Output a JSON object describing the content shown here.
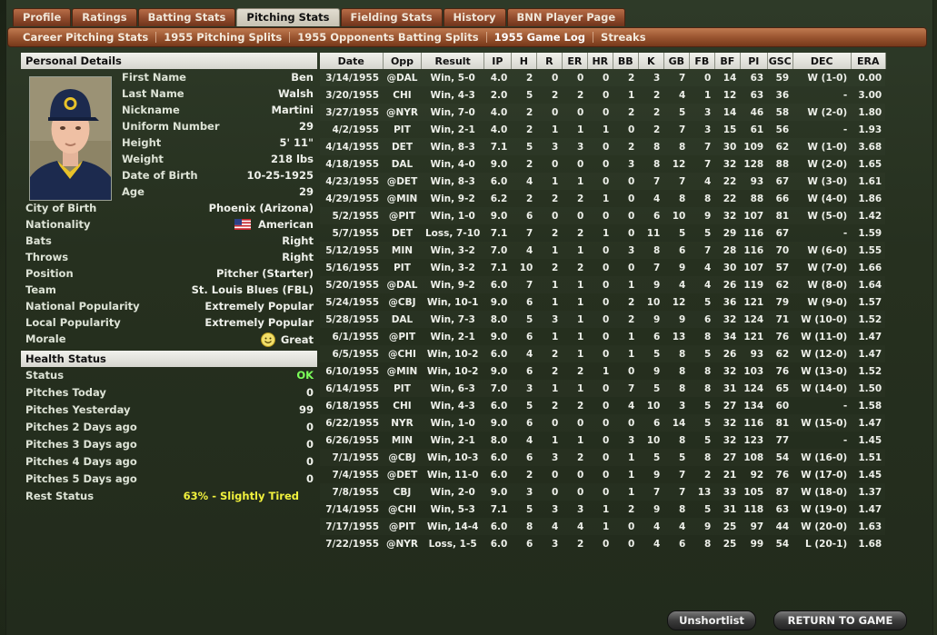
{
  "tabs": [
    {
      "label": "Profile"
    },
    {
      "label": "Ratings"
    },
    {
      "label": "Batting Stats"
    },
    {
      "label": "Pitching Stats"
    },
    {
      "label": "Fielding Stats"
    },
    {
      "label": "History"
    },
    {
      "label": "BNN Player Page"
    }
  ],
  "subtabs": [
    {
      "label": "Career Pitching Stats"
    },
    {
      "label": "1955 Pitching Splits"
    },
    {
      "label": "1955 Opponents Batting Splits"
    },
    {
      "label": "1955 Game Log"
    },
    {
      "label": "Streaks"
    }
  ],
  "personal": {
    "title": "Personal Details",
    "first_name_label": "First Name",
    "first_name": "Ben",
    "last_name_label": "Last Name",
    "last_name": "Walsh",
    "nickname_label": "Nickname",
    "nickname": "Martini",
    "uniform_label": "Uniform Number",
    "uniform": "29",
    "height_label": "Height",
    "height": "5' 11\"",
    "weight_label": "Weight",
    "weight": "218 lbs",
    "dob_label": "Date of Birth",
    "dob": "10-25-1925",
    "age_label": "Age",
    "age": "29",
    "city_label": "City of Birth",
    "city": "Phoenix (Arizona)",
    "nationality_label": "Nationality",
    "nationality": "American",
    "bats_label": "Bats",
    "bats": "Right",
    "throws_label": "Throws",
    "throws": "Right",
    "position_label": "Position",
    "position": "Pitcher (Starter)",
    "team_label": "Team",
    "team": "St. Louis Blues (FBL)",
    "natpop_label": "National Popularity",
    "natpop": "Extremely Popular",
    "locpop_label": "Local Popularity",
    "locpop": "Extremely Popular",
    "morale_label": "Morale",
    "morale": "Great"
  },
  "health": {
    "title": "Health Status",
    "status_label": "Status",
    "status": "OK",
    "today_label": "Pitches Today",
    "today": "0",
    "yesterday_label": "Pitches Yesterday",
    "yesterday": "99",
    "d2_label": "Pitches 2 Days ago",
    "d2": "0",
    "d3_label": "Pitches 3 Days ago",
    "d3": "0",
    "d4_label": "Pitches 4 Days ago",
    "d4": "0",
    "d5_label": "Pitches 5 Days ago",
    "d5": "0",
    "rest_label": "Rest Status",
    "rest": "63% - Slightly Tired"
  },
  "gamelog": {
    "headers": [
      "Date",
      "Opp",
      "Result",
      "IP",
      "H",
      "R",
      "ER",
      "HR",
      "BB",
      "K",
      "GB",
      "FB",
      "BF",
      "PI",
      "GSC",
      "DEC",
      "ERA"
    ],
    "rows": [
      [
        "3/14/1955",
        "@DAL",
        "Win, 5-0",
        "4.0",
        "2",
        "0",
        "0",
        "0",
        "2",
        "3",
        "7",
        "0",
        "14",
        "63",
        "59",
        "W (1-0)",
        "0.00"
      ],
      [
        "3/20/1955",
        "CHI",
        "Win, 4-3",
        "2.0",
        "5",
        "2",
        "2",
        "0",
        "1",
        "2",
        "4",
        "1",
        "12",
        "63",
        "36",
        "-",
        "3.00"
      ],
      [
        "3/27/1955",
        "@NYR",
        "Win, 7-0",
        "4.0",
        "2",
        "0",
        "0",
        "0",
        "2",
        "2",
        "5",
        "3",
        "14",
        "46",
        "58",
        "W (2-0)",
        "1.80"
      ],
      [
        "4/2/1955",
        "PIT",
        "Win, 2-1",
        "4.0",
        "2",
        "1",
        "1",
        "1",
        "0",
        "2",
        "7",
        "3",
        "15",
        "61",
        "56",
        "-",
        "1.93"
      ],
      [
        "4/14/1955",
        "DET",
        "Win, 8-3",
        "7.1",
        "5",
        "3",
        "3",
        "0",
        "2",
        "8",
        "8",
        "7",
        "30",
        "109",
        "62",
        "W (1-0)",
        "3.68"
      ],
      [
        "4/18/1955",
        "DAL",
        "Win, 4-0",
        "9.0",
        "2",
        "0",
        "0",
        "0",
        "3",
        "8",
        "12",
        "7",
        "32",
        "128",
        "88",
        "W (2-0)",
        "1.65"
      ],
      [
        "4/23/1955",
        "@DET",
        "Win, 8-3",
        "6.0",
        "4",
        "1",
        "1",
        "0",
        "0",
        "7",
        "7",
        "4",
        "22",
        "93",
        "67",
        "W (3-0)",
        "1.61"
      ],
      [
        "4/29/1955",
        "@MIN",
        "Win, 9-2",
        "6.2",
        "2",
        "2",
        "2",
        "1",
        "0",
        "4",
        "8",
        "8",
        "22",
        "88",
        "66",
        "W (4-0)",
        "1.86"
      ],
      [
        "5/2/1955",
        "@PIT",
        "Win, 1-0",
        "9.0",
        "6",
        "0",
        "0",
        "0",
        "0",
        "6",
        "10",
        "9",
        "32",
        "107",
        "81",
        "W (5-0)",
        "1.42"
      ],
      [
        "5/7/1955",
        "DET",
        "Loss, 7-10",
        "7.1",
        "7",
        "2",
        "2",
        "1",
        "0",
        "11",
        "5",
        "5",
        "29",
        "116",
        "67",
        "-",
        "1.59"
      ],
      [
        "5/12/1955",
        "MIN",
        "Win, 3-2",
        "7.0",
        "4",
        "1",
        "1",
        "0",
        "3",
        "8",
        "6",
        "7",
        "28",
        "116",
        "70",
        "W (6-0)",
        "1.55"
      ],
      [
        "5/16/1955",
        "PIT",
        "Win, 3-2",
        "7.1",
        "10",
        "2",
        "2",
        "0",
        "0",
        "7",
        "9",
        "4",
        "30",
        "107",
        "57",
        "W (7-0)",
        "1.66"
      ],
      [
        "5/20/1955",
        "@DAL",
        "Win, 9-2",
        "6.0",
        "7",
        "1",
        "1",
        "0",
        "1",
        "9",
        "4",
        "4",
        "26",
        "119",
        "62",
        "W (8-0)",
        "1.64"
      ],
      [
        "5/24/1955",
        "@CBJ",
        "Win, 10-1",
        "9.0",
        "6",
        "1",
        "1",
        "0",
        "2",
        "10",
        "12",
        "5",
        "36",
        "121",
        "79",
        "W (9-0)",
        "1.57"
      ],
      [
        "5/28/1955",
        "DAL",
        "Win, 7-3",
        "8.0",
        "5",
        "3",
        "1",
        "0",
        "2",
        "9",
        "9",
        "6",
        "32",
        "124",
        "71",
        "W (10-0)",
        "1.52"
      ],
      [
        "6/1/1955",
        "@PIT",
        "Win, 2-1",
        "9.0",
        "6",
        "1",
        "1",
        "0",
        "1",
        "6",
        "13",
        "8",
        "34",
        "121",
        "76",
        "W (11-0)",
        "1.47"
      ],
      [
        "6/5/1955",
        "@CHI",
        "Win, 10-2",
        "6.0",
        "4",
        "2",
        "1",
        "0",
        "1",
        "5",
        "8",
        "5",
        "26",
        "93",
        "62",
        "W (12-0)",
        "1.47"
      ],
      [
        "6/10/1955",
        "@MIN",
        "Win, 10-2",
        "9.0",
        "6",
        "2",
        "2",
        "1",
        "0",
        "9",
        "8",
        "8",
        "32",
        "103",
        "76",
        "W (13-0)",
        "1.52"
      ],
      [
        "6/14/1955",
        "PIT",
        "Win, 6-3",
        "7.0",
        "3",
        "1",
        "1",
        "0",
        "7",
        "5",
        "8",
        "8",
        "31",
        "124",
        "65",
        "W (14-0)",
        "1.50"
      ],
      [
        "6/18/1955",
        "CHI",
        "Win, 4-3",
        "6.0",
        "5",
        "2",
        "2",
        "0",
        "4",
        "10",
        "3",
        "5",
        "27",
        "134",
        "60",
        "-",
        "1.58"
      ],
      [
        "6/22/1955",
        "NYR",
        "Win, 1-0",
        "9.0",
        "6",
        "0",
        "0",
        "0",
        "0",
        "6",
        "14",
        "5",
        "32",
        "116",
        "81",
        "W (15-0)",
        "1.47"
      ],
      [
        "6/26/1955",
        "MIN",
        "Win, 2-1",
        "8.0",
        "4",
        "1",
        "1",
        "0",
        "3",
        "10",
        "8",
        "5",
        "32",
        "123",
        "77",
        "-",
        "1.45"
      ],
      [
        "7/1/1955",
        "@CBJ",
        "Win, 10-3",
        "6.0",
        "6",
        "3",
        "2",
        "0",
        "1",
        "5",
        "5",
        "8",
        "27",
        "108",
        "54",
        "W (16-0)",
        "1.51"
      ],
      [
        "7/4/1955",
        "@DET",
        "Win, 11-0",
        "6.0",
        "2",
        "0",
        "0",
        "0",
        "1",
        "9",
        "7",
        "2",
        "21",
        "92",
        "76",
        "W (17-0)",
        "1.45"
      ],
      [
        "7/8/1955",
        "CBJ",
        "Win, 2-0",
        "9.0",
        "3",
        "0",
        "0",
        "0",
        "1",
        "7",
        "7",
        "13",
        "33",
        "105",
        "87",
        "W (18-0)",
        "1.37"
      ],
      [
        "7/14/1955",
        "@CHI",
        "Win, 5-3",
        "7.1",
        "5",
        "3",
        "3",
        "1",
        "2",
        "9",
        "8",
        "5",
        "31",
        "118",
        "63",
        "W (19-0)",
        "1.47"
      ],
      [
        "7/17/1955",
        "@PIT",
        "Win, 14-4",
        "6.0",
        "8",
        "4",
        "4",
        "1",
        "0",
        "4",
        "4",
        "9",
        "25",
        "97",
        "44",
        "W (20-0)",
        "1.63"
      ],
      [
        "7/22/1955",
        "@NYR",
        "Loss, 1-5",
        "6.0",
        "6",
        "3",
        "2",
        "0",
        "0",
        "4",
        "6",
        "8",
        "25",
        "99",
        "54",
        "L (20-1)",
        "1.68"
      ]
    ]
  },
  "buttons": {
    "unshortlist": "Unshortlist",
    "return": "RETURN TO GAME"
  },
  "colors": {
    "tab_active": "#d8d3c6",
    "tab": "#8f4a2c",
    "ok": "#7cff5a",
    "tired": "#f1f13d",
    "background": "#27311f"
  }
}
